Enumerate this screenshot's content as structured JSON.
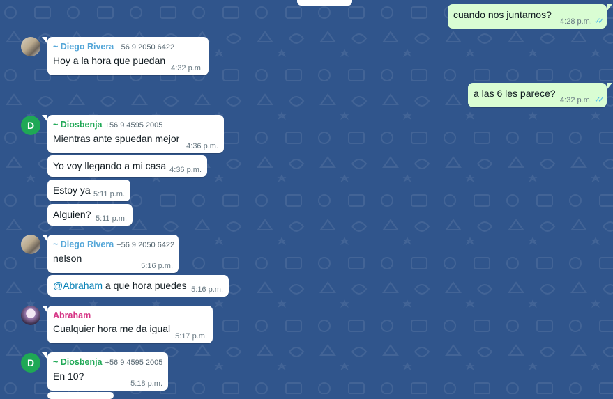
{
  "colors": {
    "background": "#30558c",
    "incoming_bubble": "#ffffff",
    "outgoing_bubble": "#d9fdd3",
    "diego_name": "#53a6d8",
    "diosbenja_name": "#1fa855",
    "abraham_name": "#d63384",
    "read_ticks": "#53bdeb"
  },
  "messages": [
    {
      "text": "cuando nos juntamos?",
      "time": "4:28 p.m.",
      "ticks": "✓✓"
    },
    {
      "sender": "~ Diego Rivera",
      "phone": "+56 9 2050 6422",
      "text": "Hoy a la hora que puedan",
      "time": "4:32 p.m."
    },
    {
      "text": "a las 6 les parece?",
      "time": "4:32 p.m.",
      "ticks": "✓✓"
    },
    {
      "sender": "~ Diosbenja",
      "phone": "+56 9 4595 2005",
      "avatar_letter": "D",
      "text": "Mientras ante spuedan mejor",
      "time": "4:36 p.m."
    },
    {
      "text": "Yo voy llegando a mi casa",
      "time": "4:36 p.m."
    },
    {
      "text": "Estoy ya",
      "time": "5:11 p.m."
    },
    {
      "text": "Alguien?",
      "time": "5:11 p.m."
    },
    {
      "sender": "~ Diego Rivera",
      "phone": "+56 9 2050 6422",
      "text": "nelson",
      "time": "5:16 p.m."
    },
    {
      "mention": "@Abraham",
      "text": " a que hora puedes",
      "time": "5:16 p.m."
    },
    {
      "sender": "Abraham",
      "text": "Cualquier hora me da igual",
      "time": "5:17 p.m."
    },
    {
      "sender": "~ Diosbenja",
      "phone": "+56 9 4595 2005",
      "avatar_letter": "D",
      "text": "En 10?",
      "time": "5:18 p.m."
    }
  ]
}
